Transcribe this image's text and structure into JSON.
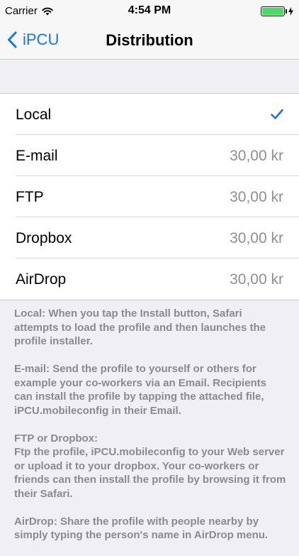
{
  "status_bar": {
    "carrier": "Carrier",
    "time": "4:54 PM",
    "battery_level": 1.0,
    "battery_color": "#4cd964"
  },
  "nav": {
    "back_label": "iPCU",
    "back_icon": "chevron-left-icon",
    "title": "Distribution"
  },
  "accent_color": "#1a73e8",
  "options": [
    {
      "label": "Local",
      "price": "",
      "selected": true
    },
    {
      "label": "E-mail",
      "price": "30,00 kr",
      "selected": false
    },
    {
      "label": "FTP",
      "price": "30,00 kr",
      "selected": false
    },
    {
      "label": "Dropbox",
      "price": "30,00 kr",
      "selected": false
    },
    {
      "label": "AirDrop",
      "price": "30,00 kr",
      "selected": false
    }
  ],
  "footer": {
    "local": "Local: When you tap the Install button, Safari attempts to load the profile and then launches the profile installer.",
    "email": "E-mail: Send the profile to yourself or others for example your co-workers via an Email. Recipients can install the profile by tapping the attached file, iPCU.mobileconfig in their Email.",
    "ftp": "FTP or Dropbox:\nFtp the profile, iPCU.mobileconfig to your Web server or upload it to your dropbox. Your co-workers or friends can then install the profile by browsing it from their Safari.",
    "airdrop": "AirDrop: Share the profile with people nearby by simply typing the person's name in AirDrop menu."
  }
}
